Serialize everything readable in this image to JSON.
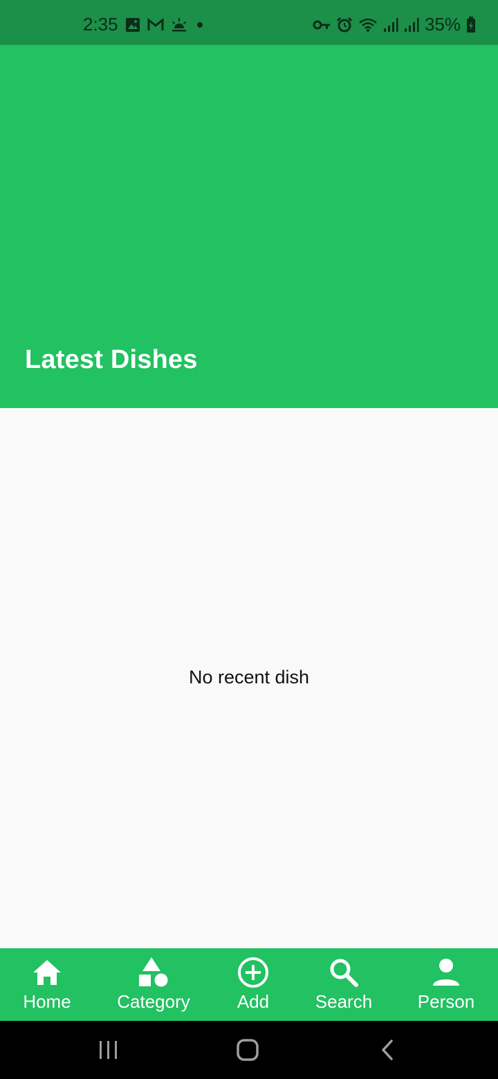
{
  "status_bar": {
    "time": "2:35",
    "battery": "35%",
    "icons_left": [
      "image-icon",
      "gmail-icon",
      "weather-icon",
      "dot-icon"
    ],
    "icons_right": [
      "vpn-key-icon",
      "alarm-icon",
      "wifi-icon",
      "signal-icon",
      "signal-icon",
      "battery-icon"
    ]
  },
  "header": {
    "title": "Latest Dishes",
    "background": "#22c162"
  },
  "main": {
    "empty_message": "No recent dish"
  },
  "bottom_nav": {
    "items": [
      {
        "label": "Home",
        "icon": "home-icon"
      },
      {
        "label": "Category",
        "icon": "category-icon"
      },
      {
        "label": "Add",
        "icon": "add-circle-icon"
      },
      {
        "label": "Search",
        "icon": "search-icon"
      },
      {
        "label": "Person",
        "icon": "person-icon"
      }
    ],
    "background": "#22c162"
  },
  "system_nav": {
    "buttons": [
      "recents-icon",
      "home-button-icon",
      "back-icon"
    ]
  }
}
